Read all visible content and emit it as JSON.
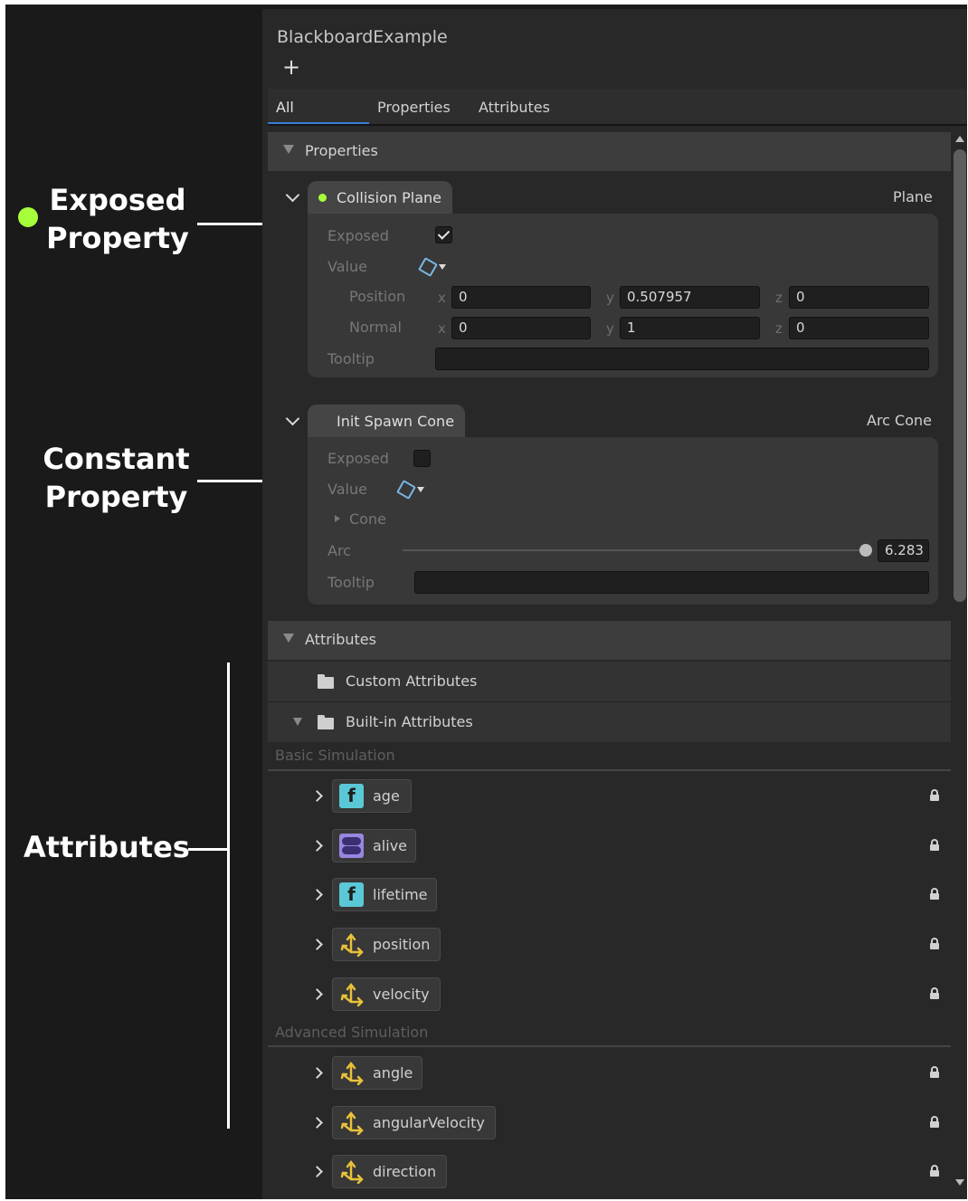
{
  "callouts": {
    "exposed_line1": "Exposed",
    "exposed_line2": "Property",
    "constant_line1": "Constant",
    "constant_line2": "Property",
    "attributes": "Attributes",
    "exposed_dot_color": "#a6ff3a"
  },
  "window": {
    "title": "BlackboardExample",
    "add_label": "+"
  },
  "tabs": {
    "all": "All",
    "properties": "Properties",
    "attributes": "Attributes",
    "active": "All"
  },
  "properties_section": {
    "label": "Properties"
  },
  "collision_plane": {
    "name": "Collision Plane",
    "type": "Plane",
    "exposed_label": "Exposed",
    "exposed_checked": true,
    "value_label": "Value",
    "position_label": "Position",
    "normal_label": "Normal",
    "tooltip_label": "Tooltip",
    "position": {
      "x": "0",
      "y": "0.507957",
      "z": "0"
    },
    "normal": {
      "x": "0",
      "y": "1",
      "z": "0"
    },
    "axis_x": "x",
    "axis_y": "y",
    "axis_z": "z",
    "tooltip_value": ""
  },
  "init_spawn_cone": {
    "name": "Init Spawn Cone",
    "type": "Arc Cone",
    "exposed_label": "Exposed",
    "exposed_checked": false,
    "value_label": "Value",
    "cone_label": "Cone",
    "arc_label": "Arc",
    "arc_value": "6.283",
    "tooltip_label": "Tooltip",
    "tooltip_value": ""
  },
  "attributes_section": {
    "label": "Attributes",
    "custom_label": "Custom Attributes",
    "builtin_label": "Built-in Attributes",
    "basic_label": "Basic Simulation",
    "advanced_label": "Advanced Simulation",
    "basic": [
      {
        "name": "age",
        "icon": "float-icon"
      },
      {
        "name": "alive",
        "icon": "bool-icon"
      },
      {
        "name": "lifetime",
        "icon": "float-icon"
      },
      {
        "name": "position",
        "icon": "vector3-icon"
      },
      {
        "name": "velocity",
        "icon": "vector3-icon"
      }
    ],
    "advanced": [
      {
        "name": "angle",
        "icon": "vector3-icon"
      },
      {
        "name": "angularVelocity",
        "icon": "vector3-icon"
      },
      {
        "name": "direction",
        "icon": "vector3-icon"
      }
    ]
  },
  "icons": {
    "float_glyph": "f",
    "accent_teal": "#5ac8d6",
    "accent_purple": "#9a86e0",
    "accent_yellow": "#e8c23a",
    "tab_underline": "#3a7bd5"
  }
}
